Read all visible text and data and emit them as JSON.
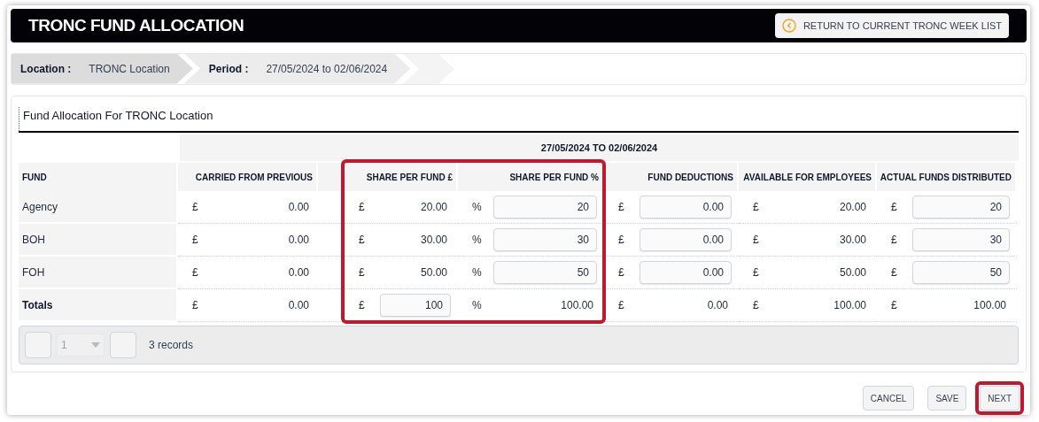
{
  "header": {
    "title": "TRONC FUND ALLOCATION",
    "return_button": "RETURN TO CURRENT TRONC WEEK LIST"
  },
  "breadcrumb": [
    {
      "label": "Location :",
      "value": "TRONC Location"
    },
    {
      "label": "Period :",
      "value": "27/05/2024 to 02/06/2024"
    }
  ],
  "panel": {
    "title": "Fund Allocation For TRONC Location",
    "period_heading": "27/05/2024 TO 02/06/2024"
  },
  "table": {
    "columns": [
      {
        "label": "FUND",
        "highlighted": false
      },
      {
        "label": "CARRIED FROM PREVIOUS",
        "highlighted": false
      },
      {
        "label": "SHARE PER FUND £",
        "highlighted": true
      },
      {
        "label": "SHARE PER FUND %",
        "highlighted": true
      },
      {
        "label": "FUND DEDUCTIONS",
        "highlighted": false
      },
      {
        "label": "AVAILABLE FOR EMPLOYEES",
        "highlighted": false
      },
      {
        "label": "ACTUAL FUNDS DISTRIBUTED",
        "highlighted": false
      }
    ],
    "rows": [
      {
        "kind": "fund",
        "cells": [
          {
            "kind": "label",
            "value": "Agency"
          },
          {
            "symbol": "£",
            "value": "0.00",
            "kind": "text"
          },
          {
            "symbol": "£",
            "value": "20.00",
            "kind": "text"
          },
          {
            "symbol": "%",
            "value": "20",
            "kind": "input"
          },
          {
            "symbol": "£",
            "value": "0.00",
            "kind": "input"
          },
          {
            "symbol": "£",
            "value": "20.00",
            "kind": "text"
          },
          {
            "symbol": "£",
            "value": "20",
            "kind": "input"
          }
        ]
      },
      {
        "kind": "fund",
        "cells": [
          {
            "kind": "label",
            "value": "BOH"
          },
          {
            "symbol": "£",
            "value": "0.00",
            "kind": "text"
          },
          {
            "symbol": "£",
            "value": "30.00",
            "kind": "text"
          },
          {
            "symbol": "%",
            "value": "30",
            "kind": "input"
          },
          {
            "symbol": "£",
            "value": "0.00",
            "kind": "input"
          },
          {
            "symbol": "£",
            "value": "30.00",
            "kind": "text"
          },
          {
            "symbol": "£",
            "value": "30",
            "kind": "input"
          }
        ]
      },
      {
        "kind": "fund",
        "cells": [
          {
            "kind": "label",
            "value": "FOH"
          },
          {
            "symbol": "£",
            "value": "0.00",
            "kind": "text"
          },
          {
            "symbol": "£",
            "value": "50.00",
            "kind": "text"
          },
          {
            "symbol": "%",
            "value": "50",
            "kind": "input"
          },
          {
            "symbol": "£",
            "value": "0.00",
            "kind": "input"
          },
          {
            "symbol": "£",
            "value": "50.00",
            "kind": "text"
          },
          {
            "symbol": "£",
            "value": "50",
            "kind": "input"
          }
        ]
      },
      {
        "kind": "total",
        "cells": [
          {
            "kind": "label",
            "value": "Totals"
          },
          {
            "symbol": "£",
            "value": "0.00",
            "kind": "text"
          },
          {
            "symbol": "£",
            "value": "100",
            "kind": "input"
          },
          {
            "symbol": "%",
            "value": "100.00",
            "kind": "text"
          },
          {
            "symbol": "£",
            "value": "0.00",
            "kind": "text"
          },
          {
            "symbol": "£",
            "value": "100.00",
            "kind": "text"
          },
          {
            "symbol": "£",
            "value": "100.00",
            "kind": "text"
          }
        ]
      }
    ]
  },
  "pager": {
    "page": "1",
    "records": "3 records"
  },
  "actions": [
    {
      "label": "CANCEL",
      "highlighted": false
    },
    {
      "label": "SAVE",
      "highlighted": false
    },
    {
      "label": "NEXT",
      "highlighted": true
    }
  ]
}
